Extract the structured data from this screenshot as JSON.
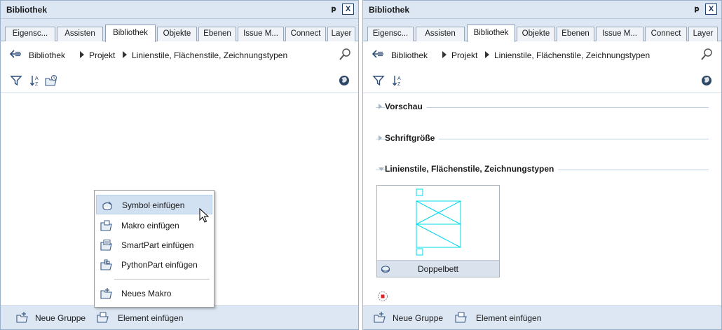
{
  "left_panel": {
    "title": "Bibliothek",
    "pin": "ᵖ",
    "close": "X",
    "tabs": [
      "Eigensc...",
      "Assisten",
      "Bibliothek",
      "Objekte",
      "Ebenen",
      "Issue M...",
      "Connect",
      "Layer"
    ],
    "active_tab": "Bibliothek",
    "breadcrumb": [
      "Bibliothek",
      "Projekt",
      "Linienstile, Flächenstile, Zeichnungstypen"
    ],
    "context_menu": {
      "items": [
        "Symbol einfügen",
        "Makro einfügen",
        "SmartPart einfügen",
        "PythonPart einfügen"
      ],
      "extra": "Neues Makro",
      "hovered": "Symbol einfügen"
    },
    "footer": {
      "new_group": "Neue Gruppe",
      "insert_element": "Element einfügen"
    }
  },
  "right_panel": {
    "title": "Bibliothek",
    "pin": "ᵖ",
    "close": "X",
    "tabs": [
      "Eigensc...",
      "Assisten",
      "Bibliothek",
      "Objekte",
      "Ebenen",
      "Issue M...",
      "Connect",
      "Layer"
    ],
    "active_tab": "Bibliothek",
    "breadcrumb": [
      "Bibliothek",
      "Projekt",
      "Linienstile, Flächenstile, Zeichnungstypen"
    ],
    "sections": [
      {
        "title": "Vorschau",
        "expanded": false
      },
      {
        "title": "Schriftgröße",
        "expanded": false
      },
      {
        "title": "Linienstile, Flächenstile, Zeichnungstypen",
        "expanded": true
      }
    ],
    "tile": {
      "label": "Doppelbett"
    },
    "footer": {
      "new_group": "Neue Gruppe",
      "insert_element": "Element einfügen"
    }
  },
  "colors": {
    "header_bg": "#dde7f3",
    "border": "#9ab1cc",
    "menu_hover": "#d2e1f2",
    "symbol_line": "#00d8e8",
    "section_line": "#b9d0e8"
  }
}
